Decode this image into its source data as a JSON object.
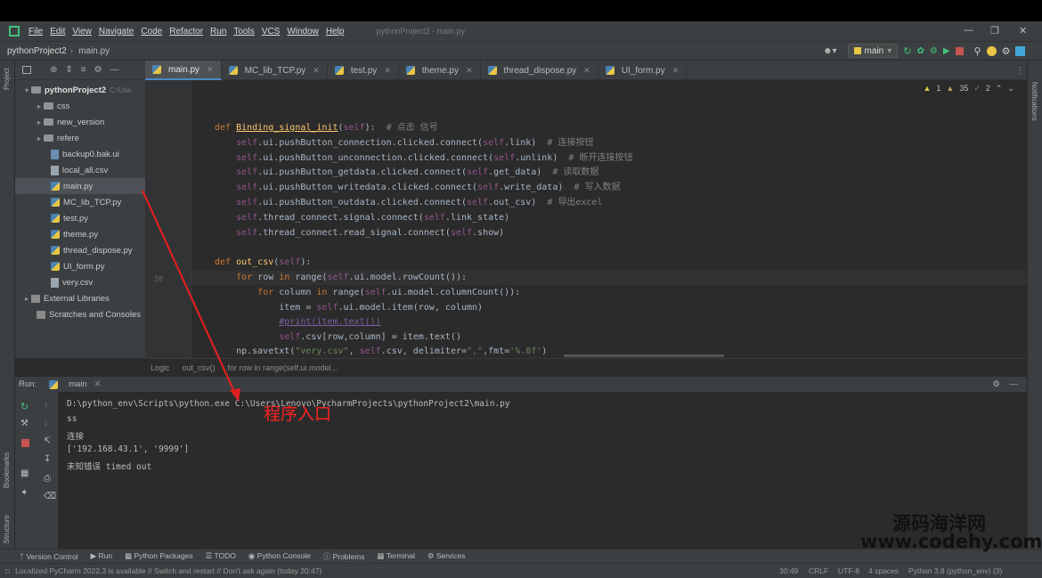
{
  "menubar": {
    "items": [
      "File",
      "Edit",
      "View",
      "Navigate",
      "Code",
      "Refactor",
      "Run",
      "Tools",
      "VCS",
      "Window",
      "Help"
    ],
    "window_title": "pythonProject2 - main.py"
  },
  "navbar": {
    "project": "pythonProject2",
    "file": "main.py",
    "run_config": "main"
  },
  "left_strip": {
    "project_label": "Project",
    "bookmarks_label": "Bookmarks",
    "structure_label": "Structure"
  },
  "right_strip": {
    "notifications_label": "Notifications"
  },
  "project_tree": {
    "root": "pythonProject2",
    "root_path": "C:\\Use",
    "items": [
      {
        "label": "css",
        "type": "folder"
      },
      {
        "label": "new_version",
        "type": "folder"
      },
      {
        "label": "refere",
        "type": "folder"
      },
      {
        "label": "backup0.bak.ui",
        "type": "file"
      },
      {
        "label": "local_all.csv",
        "type": "csv"
      },
      {
        "label": "main.py",
        "type": "py"
      },
      {
        "label": "MC_lib_TCP.py",
        "type": "py"
      },
      {
        "label": "test.py",
        "type": "py"
      },
      {
        "label": "theme.py",
        "type": "py"
      },
      {
        "label": "thread_dispose.py",
        "type": "py"
      },
      {
        "label": "UI_form.py",
        "type": "py"
      },
      {
        "label": "very.csv",
        "type": "csv"
      }
    ],
    "external": "External Libraries",
    "scratches": "Scratches and Consoles"
  },
  "tabs": [
    "main.py",
    "MC_lib_TCP.py",
    "test.py",
    "theme.py",
    "thread_dispose.py",
    "UI_form.py"
  ],
  "inspections": {
    "warnings": "1",
    "weak": "35",
    "typos": "2"
  },
  "editor": {
    "current_line_number": "38",
    "lines": [
      "def Binding_signal_init(self):  # 点击 信号",
      "    self.ui.pushButton_connection.clicked.connect(self.link)  # 连接按钮",
      "    self.ui.pushButton_unconnection.clicked.connect(self.unlink)  # 断开连接按钮",
      "    self.ui.pushButton_getdata.clicked.connect(self.get_data)  # 读取数据",
      "    self.ui.pushButton_writedata.clicked.connect(self.write_data)  # 写入数据",
      "    self.ui.pushButton_outdata.clicked.connect(self.out_csv)  # 导出excel",
      "    self.thread_connect.signal.connect(self.link_state)",
      "    self.thread_connect.read_signal.connect(self.show)",
      "",
      "def out_csv(self):",
      "    for row in range(self.ui.model.rowCount()):",
      "        for column in range(self.ui.model.columnCount()):",
      "            item = self.ui.model.item(row, column)",
      "            #print(item.text())",
      "            self.csv[row,column] = item.text()",
      "    np.savetxt(\"very.csv\", self.csv, delimiter=\",\",fmt='%.8f')"
    ]
  },
  "breadcrumb": [
    "Logic",
    "out_csv()",
    "for row in range(self.ui.model..."
  ],
  "run": {
    "label": "Run:",
    "config": "main",
    "console": [
      "D:\\python_env\\Scripts\\python.exe C:\\Users\\Lenovo\\PycharmProjects\\pythonProject2\\main.py",
      "ss",
      "连接",
      "['192.168.43.1', '9999']",
      "未知错误 timed out"
    ]
  },
  "bottom_tools": [
    "Version Control",
    "Run",
    "Python Packages",
    "TODO",
    "Python Console",
    "Problems",
    "Terminal",
    "Services"
  ],
  "status": {
    "message": "Localized PyCharm 2022.3 is available // Switch and restart // Don't ask again (today 20:47)",
    "position": "30:49",
    "line_sep": "CRLF",
    "encoding": "UTF-8",
    "indent": "4 spaces",
    "interpreter": "Python 3.8 (python_env) (3)"
  },
  "annotation": "程序入口",
  "watermark": {
    "line1": "源码海洋网",
    "line2": "www.codehy.com"
  },
  "colors": {
    "accent": "#4a88c7",
    "arrow": "#e02020",
    "run_green": "#41c27a"
  }
}
